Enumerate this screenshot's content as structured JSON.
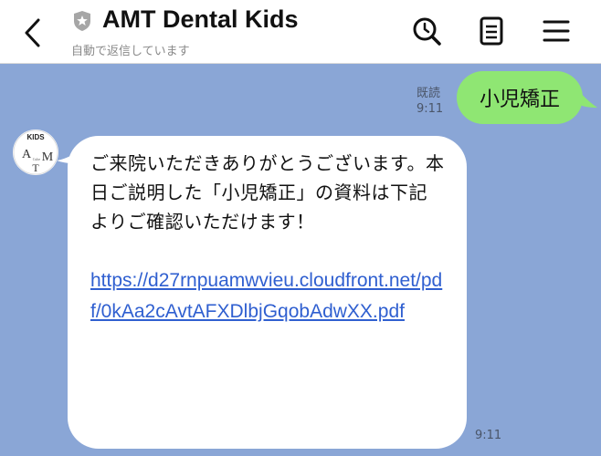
{
  "header": {
    "title": "AMT Dental Kids",
    "subtitle": "自動で返信しています",
    "icons": {
      "back": "chevron-left-icon",
      "verified": "shield-star-icon",
      "search": "search-icon",
      "notes": "notes-icon",
      "menu": "hamburger-menu-icon"
    }
  },
  "messages": {
    "sent": {
      "text": "小児矯正",
      "read_label": "既読",
      "time": "9:11"
    },
    "received": {
      "avatar_logo": {
        "top": "KIDS",
        "left": "A",
        "right": "M",
        "bottom": "T",
        "small": "Cube"
      },
      "text": "ご来院いただきありがとうございます。本日ご説明した「小児矯正」の資料は下記よりご確認いただけます！",
      "link": "https://d27rnpuamwvieu.cloudfront.net/pdf/0kAa2cAvtAFXDlbjGqobAdwXX.pdf",
      "time": "9:11"
    }
  },
  "colors": {
    "chat_background": "#8aa6d6",
    "sent_bubble": "#8fe673",
    "received_bubble": "#ffffff",
    "link": "#2f5fd0"
  }
}
